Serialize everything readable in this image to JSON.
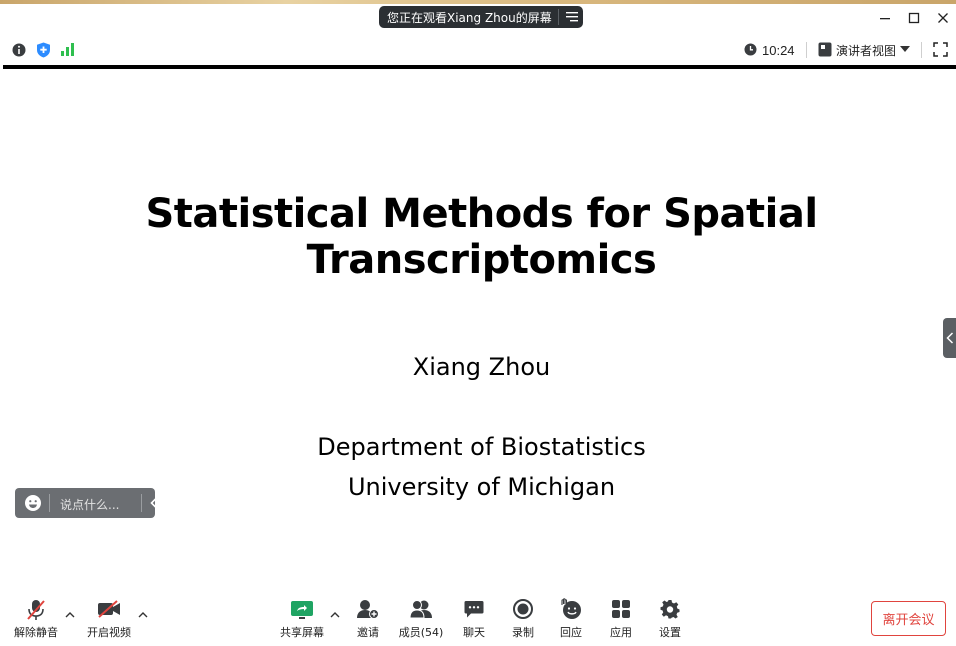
{
  "window": {
    "share_banner": "您正在观看Xiang Zhou的屏幕",
    "icons": [
      "menu-icon",
      "minimize-icon",
      "maximize-icon",
      "close-icon"
    ]
  },
  "infobar": {
    "clock": "10:24",
    "view_mode": "演讲者视图",
    "icons": [
      "info-icon",
      "shield-icon",
      "signal-icon",
      "clock-icon",
      "speaker-view-icon",
      "fullscreen-icon"
    ]
  },
  "slide": {
    "title": "Statistical Methods for Spatial Transcriptomics",
    "author": "Xiang Zhou",
    "affiliation_line1": "Department of Biostatistics",
    "affiliation_line2": "University of Michigan"
  },
  "chat": {
    "placeholder": "说点什么..."
  },
  "toolbar": {
    "unmute": "解除静音",
    "start_video": "开启视频",
    "share_screen": "共享屏幕",
    "invite": "邀请",
    "participants": "成员(54)",
    "chat": "聊天",
    "record": "录制",
    "reactions": "回应",
    "apps": "应用",
    "settings": "设置",
    "leave": "离开会议"
  },
  "colors": {
    "share_green": "#1fa463",
    "signal_green": "#2fbf4f",
    "shield_blue": "#2d8cff",
    "leave_red": "#e0443e",
    "muted_red": "#e0443e"
  }
}
